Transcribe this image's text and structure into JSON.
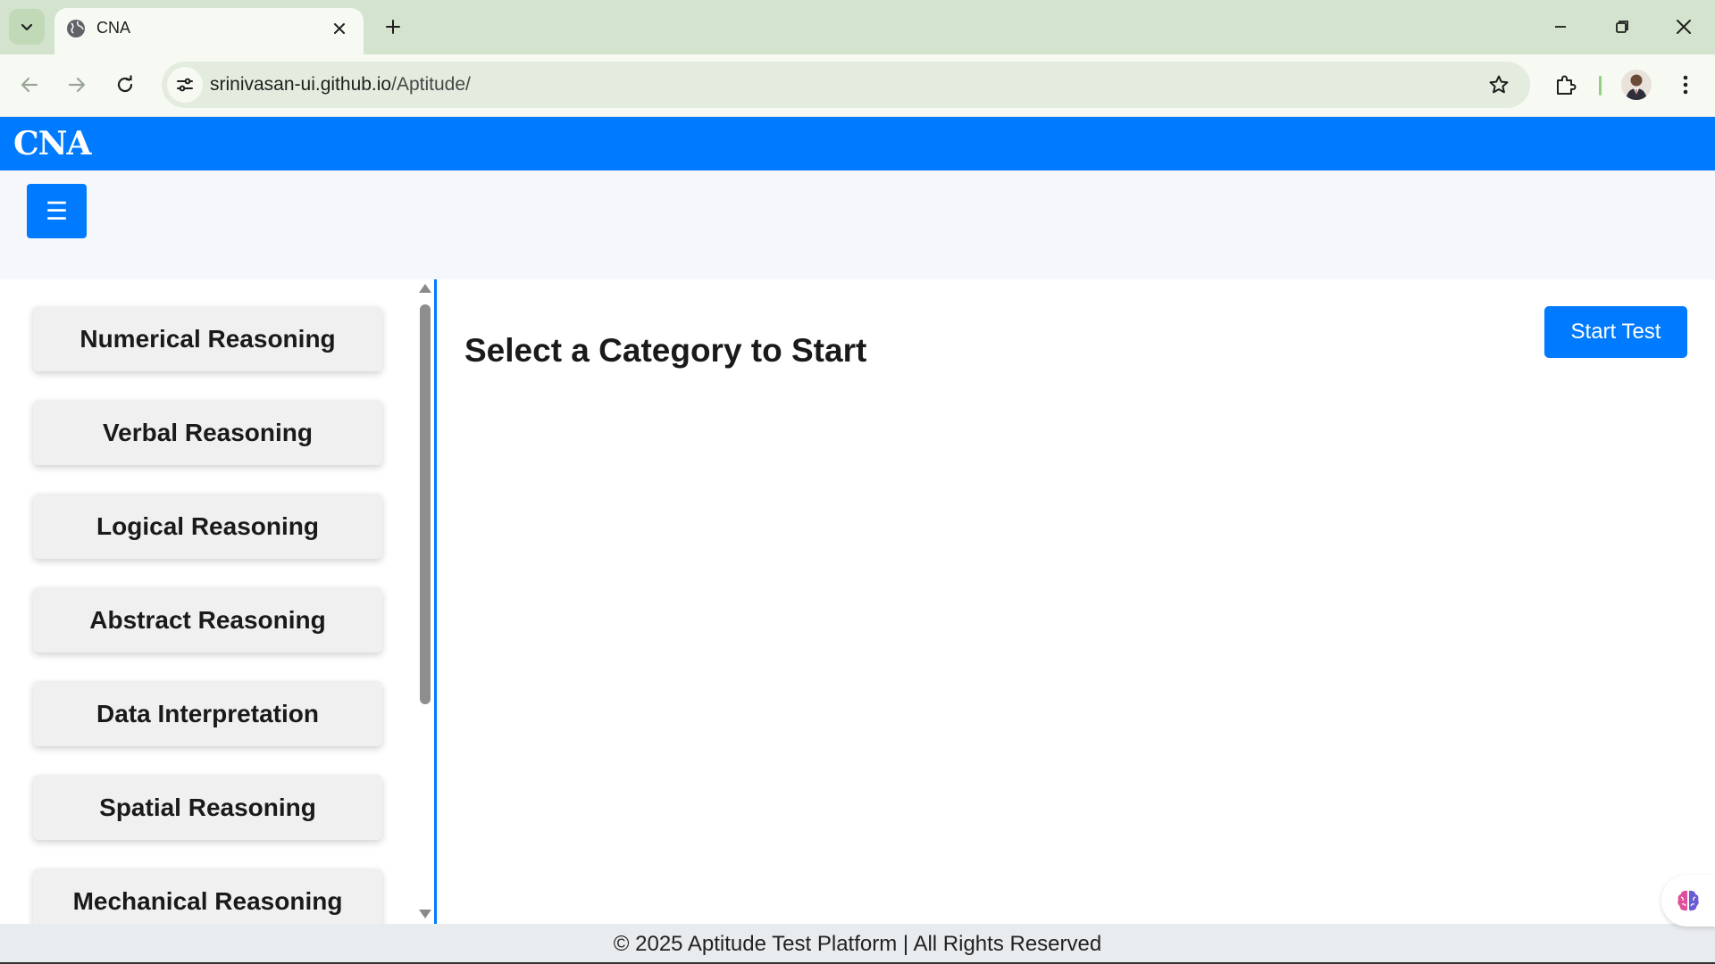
{
  "browser": {
    "tab_title": "CNA",
    "url_host": "srinivasan-ui.github.io",
    "url_path": "/Aptitude/"
  },
  "page": {
    "brand": "CNA",
    "menu_label": "☰",
    "categories": [
      "Numerical Reasoning",
      "Verbal Reasoning",
      "Logical Reasoning",
      "Abstract Reasoning",
      "Data Interpretation",
      "Spatial Reasoning",
      "Mechanical Reasoning"
    ],
    "content_title": "Select a Category to Start",
    "start_button": "Start Test",
    "footer": "© 2025 Aptitude Test Platform | All Rights Reserved"
  },
  "colors": {
    "primary": "#007bff",
    "tabstrip": "#d3e3cd",
    "toolbar": "#f6faf3",
    "subbar": "#f5f7fa",
    "footer_bg": "#e9ecef"
  },
  "icons": [
    "tab-search-icon",
    "globe-icon",
    "close-icon",
    "plus-icon",
    "minimize-icon",
    "restore-icon",
    "back-icon",
    "forward-icon",
    "reload-icon",
    "site-info-icon",
    "star-icon",
    "extensions-icon",
    "more-vert-icon",
    "brain-icon"
  ]
}
